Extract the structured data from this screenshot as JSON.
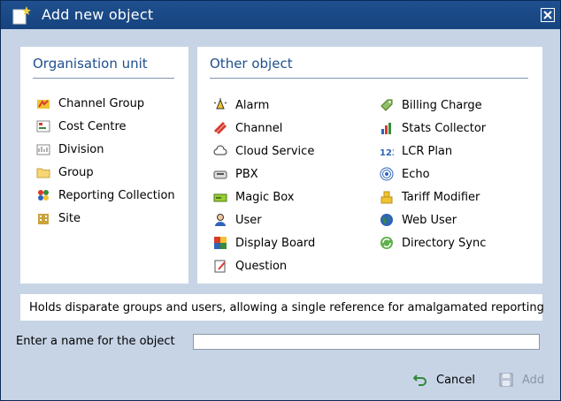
{
  "window": {
    "title": "Add new object"
  },
  "organisation": {
    "heading": "Organisation unit",
    "items": [
      {
        "label": "Channel Group",
        "icon": "channel-group-icon"
      },
      {
        "label": "Cost Centre",
        "icon": "cost-centre-icon"
      },
      {
        "label": "Division",
        "icon": "division-icon"
      },
      {
        "label": "Group",
        "icon": "folder-icon"
      },
      {
        "label": "Reporting Collection",
        "icon": "reporting-collection-icon"
      },
      {
        "label": "Site",
        "icon": "site-icon"
      }
    ]
  },
  "other": {
    "heading": "Other object",
    "col1": [
      {
        "label": "Alarm",
        "icon": "alarm-icon"
      },
      {
        "label": "Channel",
        "icon": "channel-icon"
      },
      {
        "label": "Cloud Service",
        "icon": "cloud-service-icon"
      },
      {
        "label": "PBX",
        "icon": "pbx-icon"
      },
      {
        "label": "Magic Box",
        "icon": "magic-box-icon"
      },
      {
        "label": "User",
        "icon": "user-icon"
      },
      {
        "label": "Display Board",
        "icon": "display-board-icon"
      },
      {
        "label": "Question",
        "icon": "question-icon"
      }
    ],
    "col2": [
      {
        "label": "Billing Charge",
        "icon": "billing-charge-icon"
      },
      {
        "label": "Stats Collector",
        "icon": "stats-collector-icon"
      },
      {
        "label": "LCR Plan",
        "icon": "lcr-plan-icon"
      },
      {
        "label": "Echo",
        "icon": "echo-icon"
      },
      {
        "label": "Tariff Modifier",
        "icon": "tariff-modifier-icon"
      },
      {
        "label": "Web User",
        "icon": "web-user-icon"
      },
      {
        "label": "Directory Sync",
        "icon": "directory-sync-icon"
      }
    ]
  },
  "description": "Holds disparate groups and users, allowing a single reference for amalgamated reporting",
  "name_field": {
    "label": "Enter a name for the object",
    "value": "",
    "placeholder": ""
  },
  "buttons": {
    "cancel": "Cancel",
    "add": "Add"
  },
  "colors": {
    "title_bar": "#1f4f8e",
    "background": "#c7d4e6",
    "heading": "#1f4f8e",
    "disabled": "#8b96a8"
  }
}
